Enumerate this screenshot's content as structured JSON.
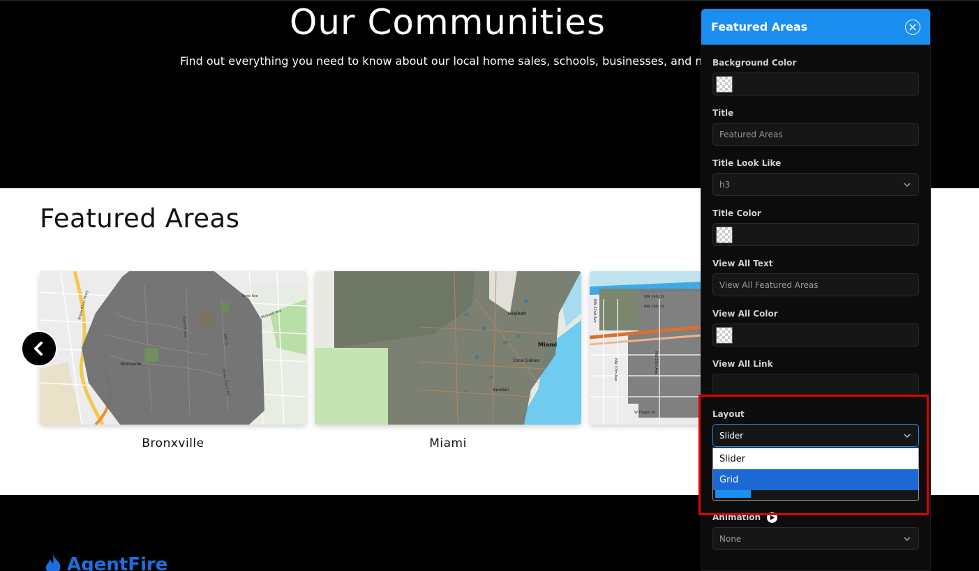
{
  "hero": {
    "title": "Our Communities",
    "subtitle": "Find out everything you need to know about our local home sales, schools, businesses, and mo"
  },
  "featured": {
    "title": "Featured Areas",
    "cards": [
      {
        "label": "Bronxville",
        "map_labels": [
          "Bronxville",
          "Rose Ave",
          "Midland Ave",
          "Elm Lk",
          "Summit Ave",
          "White Plains Rd",
          "Bronx River Pkwy"
        ]
      },
      {
        "label": "Miami",
        "map_labels": [
          "Hialeah",
          "Miami",
          "Coral Gables",
          "Kendall"
        ]
      },
      {
        "label": "",
        "map_labels": [
          "NW 14th St",
          "NW 16th St",
          "NW 42nd Ave",
          "NW 37th Ave",
          "W Flagler St",
          "NW 25th Ave"
        ]
      }
    ]
  },
  "footer": {
    "logo_text": "AgentFire"
  },
  "panel": {
    "title": "Featured Areas",
    "fields": {
      "background_color_label": "Background Color",
      "title_label": "Title",
      "title_value": "Featured Areas",
      "title_look_label": "Title Look Like",
      "title_look_value": "h3",
      "title_color_label": "Title Color",
      "view_all_text_label": "View All Text",
      "view_all_text_value": "View All Featured Areas",
      "view_all_color_label": "View All Color",
      "view_all_link_label": "View All Link",
      "view_all_link_value": "",
      "layout_label": "Layout",
      "layout_value": "Slider",
      "layout_options": [
        "Slider",
        "Grid"
      ],
      "animation_label": "Animation",
      "animation_value": "None"
    }
  },
  "colors": {
    "accent": "#1b8ff0",
    "highlight_box": "#e00000",
    "dropdown_selected": "#1c68d4"
  }
}
